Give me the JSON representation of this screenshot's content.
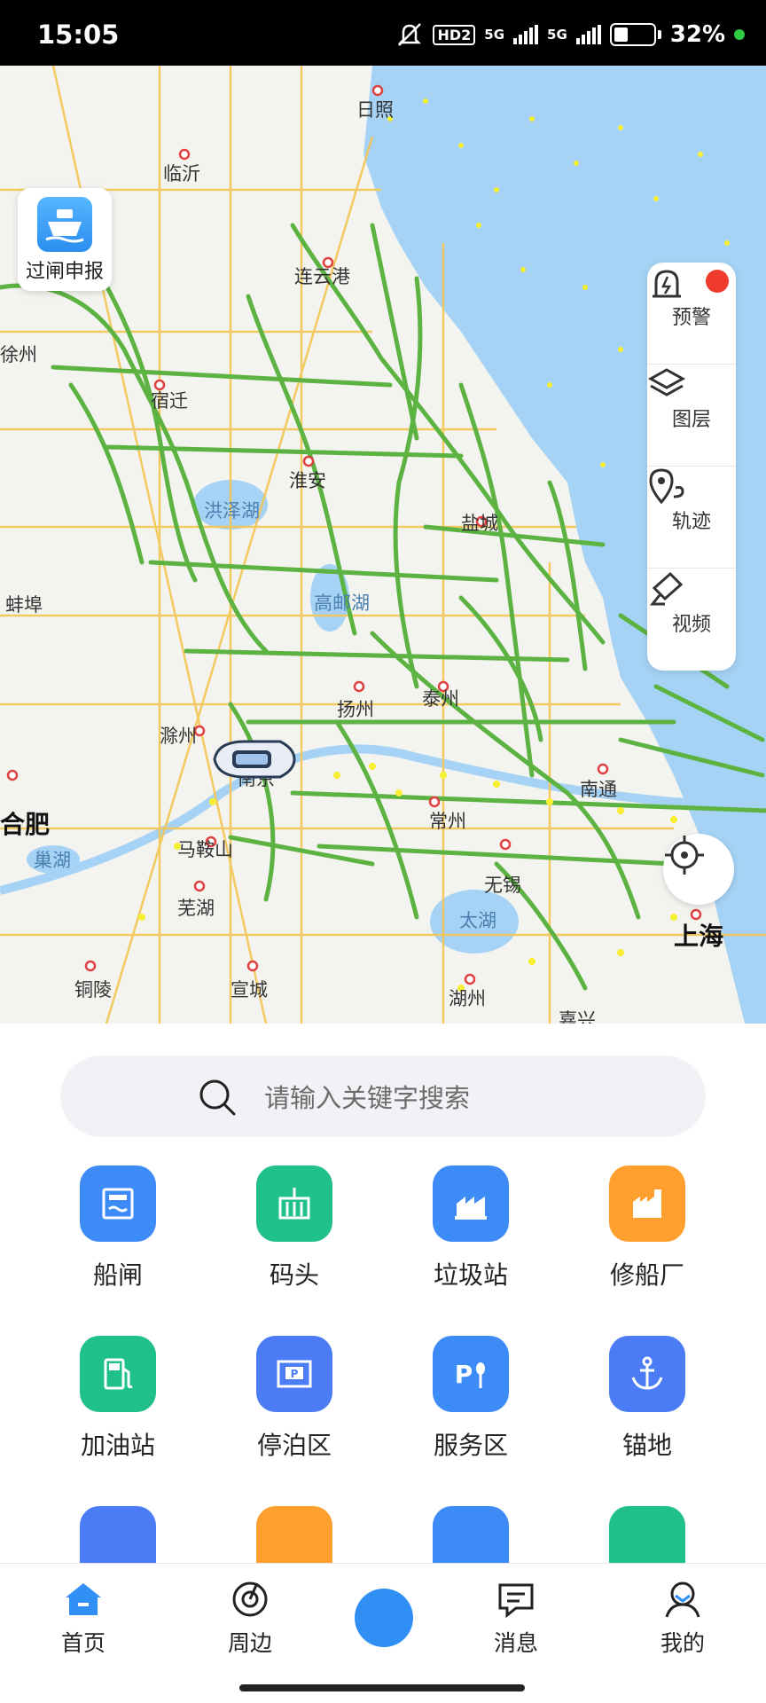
{
  "status": {
    "time": "15:05",
    "hd": "HD2",
    "net1": "5G",
    "net2": "5G",
    "battery": "32%",
    "battery_level": 0.32
  },
  "map": {
    "gate_card": {
      "label": "过闸申报",
      "icon": "ship-icon"
    },
    "side_panel": [
      {
        "label": "预警",
        "icon": "alarm-siren-icon",
        "has_badge": true
      },
      {
        "label": "图层",
        "icon": "layers-icon"
      },
      {
        "label": "轨迹",
        "icon": "track-pin-icon"
      },
      {
        "label": "视频",
        "icon": "video-camera-icon"
      }
    ],
    "cities": [
      {
        "name": "日照"
      },
      {
        "name": "临沂"
      },
      {
        "name": "连云港"
      },
      {
        "name": "徐州"
      },
      {
        "name": "宿迁"
      },
      {
        "name": "淮安"
      },
      {
        "name": "盐城"
      },
      {
        "name": "洪泽湖"
      },
      {
        "name": "高邮湖"
      },
      {
        "name": "蚌埠"
      },
      {
        "name": "滁州"
      },
      {
        "name": "扬州"
      },
      {
        "name": "泰州"
      },
      {
        "name": "南京"
      },
      {
        "name": "南通"
      },
      {
        "name": "常州"
      },
      {
        "name": "马鞍山"
      },
      {
        "name": "合肥"
      },
      {
        "name": "巢湖"
      },
      {
        "name": "芜湖"
      },
      {
        "name": "无锡"
      },
      {
        "name": "太湖"
      },
      {
        "name": "上海"
      },
      {
        "name": "铜陵"
      },
      {
        "name": "宣城"
      },
      {
        "name": "湖州"
      },
      {
        "name": "嘉兴"
      }
    ]
  },
  "search": {
    "placeholder": "请输入关键字搜索"
  },
  "grid": [
    {
      "label": "船闸",
      "icon": "ship-lock-icon",
      "color": "#3d8bf7"
    },
    {
      "label": "码头",
      "icon": "dock-icon",
      "color": "#20c08a"
    },
    {
      "label": "垃圾站",
      "icon": "garbage-station-icon",
      "color": "#3d8bf7"
    },
    {
      "label": "修船厂",
      "icon": "shipyard-icon",
      "color": "#ff9f2e"
    },
    {
      "label": "加油站",
      "icon": "fuel-station-icon",
      "color": "#20c08a"
    },
    {
      "label": "停泊区",
      "icon": "parking-area-icon",
      "color": "#4b7cf5"
    },
    {
      "label": "服务区",
      "icon": "service-area-icon",
      "color": "#3d8bf7"
    },
    {
      "label": "锚地",
      "icon": "anchor-icon",
      "color": "#4b7cf5"
    }
  ],
  "tabbar": [
    {
      "label": "首页",
      "icon": "home-icon",
      "active": true
    },
    {
      "label": "周边",
      "icon": "radar-icon"
    },
    {
      "label": "",
      "icon": "compass-icon"
    },
    {
      "label": "消息",
      "icon": "message-icon"
    },
    {
      "label": "我的",
      "icon": "profile-icon"
    }
  ]
}
